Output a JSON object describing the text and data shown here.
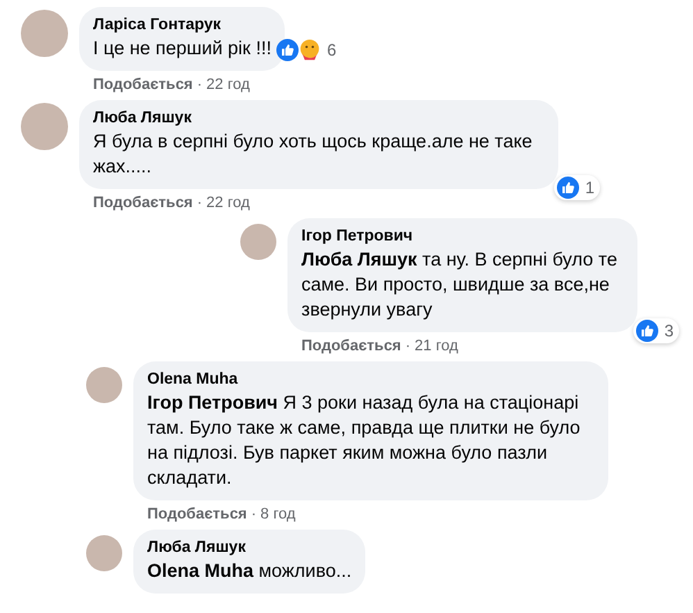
{
  "comments": [
    {
      "author": "Ларіса Гонтарук",
      "text": "І це не перший рік !!!",
      "reactions": {
        "icons": [
          {
            "kind": "like"
          },
          {
            "kind": "care"
          }
        ],
        "count": "6",
        "inline": true
      },
      "like_label": "Подобається",
      "separator": "·",
      "time": "22 год"
    },
    {
      "author": "Люба Ляшук",
      "text": "Я була в серпні було хоть щось краще.але не таке жах.....",
      "reactions": {
        "icons": [
          {
            "kind": "like"
          }
        ],
        "count": "1",
        "inline": false
      },
      "like_label": "Подобається",
      "separator": "·",
      "time": "22 год",
      "children": [
        {
          "kind": "thread-reply",
          "author": "Ігор Петрович",
          "text": "**Люба Ляшук** та ну. В серпні було те саме. Ви просто, швидше за все,не звернули увагу",
          "reactions": {
            "icons": [
              {
                "kind": "like"
              }
            ],
            "count": "3",
            "inline": false
          },
          "like_label": "Подобається",
          "separator": "·",
          "time": "21 год"
        },
        {
          "kind": "reply",
          "author": "Olena Muha",
          "text": "**Ігор Петрович** Я 3 роки назад була на стаціонарі там. Було таке ж саме, правда ще плитки не було на підлозі. Був паркет яким можна було пазли складати.",
          "like_label": "Подобається",
          "separator": "·",
          "time": "8 год"
        },
        {
          "kind": "reply",
          "author": "Люба Ляшук",
          "text": "**Olena Muha** можливо..."
        }
      ]
    }
  ]
}
